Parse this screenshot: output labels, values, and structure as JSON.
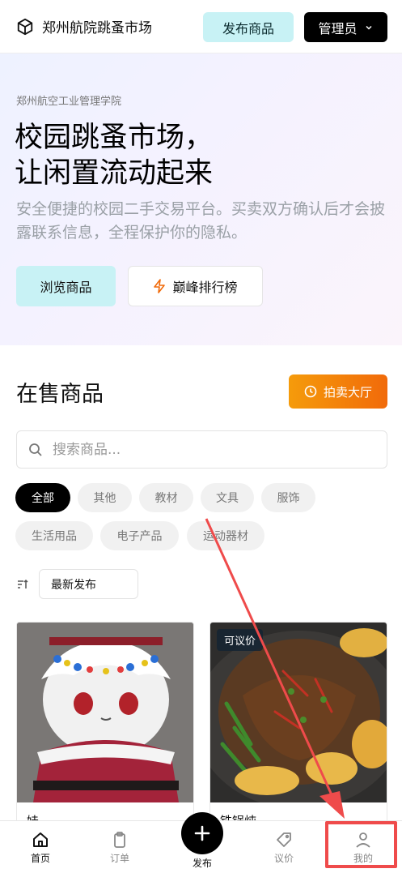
{
  "header": {
    "brand_title": "郑州航院跳蚤市场",
    "publish_label": "发布商品",
    "admin_label": "管理员"
  },
  "hero": {
    "school": "郑州航空工业管理学院",
    "title_line1": "校园跳蚤市场，",
    "title_line2": "让闲置流动起来",
    "description": "安全便捷的校园二手交易平台。买卖双方确认后才会披露联系信息，全程保护你的隐私。",
    "browse_label": "浏览商品",
    "rank_label": "巅峰排行榜"
  },
  "listing": {
    "section_title": "在售商品",
    "auction_label": "拍卖大厅",
    "search_placeholder": "搜索商品...",
    "categories": [
      "全部",
      "其他",
      "教材",
      "文具",
      "服饰",
      "生活用品",
      "电子产品",
      "运动器材"
    ],
    "sort_label": "最新发布",
    "products": [
      {
        "title": "娃",
        "tag": ""
      },
      {
        "title": "铁锅炖",
        "tag": "可议价"
      }
    ]
  },
  "nav": {
    "home": "首页",
    "orders": "订单",
    "publish": "发布",
    "bargain": "议价",
    "mine": "我的"
  },
  "colors": {
    "accent_cyan": "#c8f2f5",
    "accent_orange": "#f16a0a",
    "highlight_red": "#ef4b4b"
  }
}
